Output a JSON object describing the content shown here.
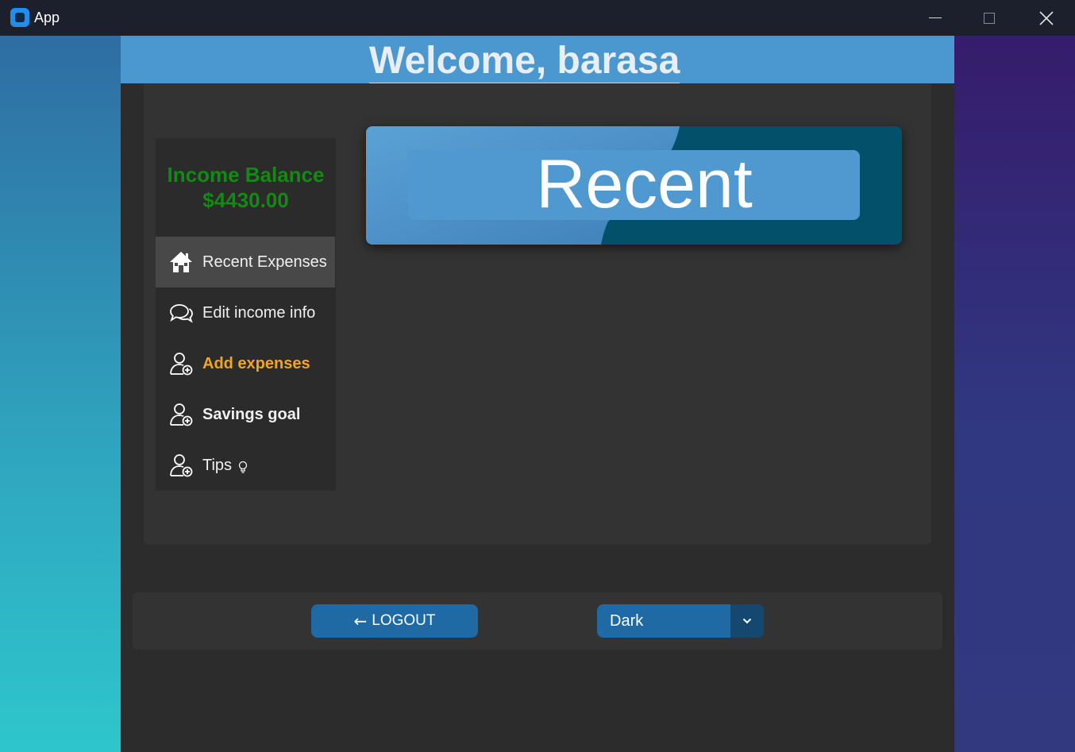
{
  "window": {
    "title": "App",
    "controls": [
      "minimize-icon",
      "maximize-icon",
      "close-icon"
    ]
  },
  "header": {
    "welcome": "Welcome, barasa"
  },
  "sidebar": {
    "balance_label": "Income Balance",
    "balance_value": "$4430.00",
    "items": [
      {
        "label": "Recent Expenses",
        "icon": "home-icon",
        "active": true
      },
      {
        "label": "Edit income info",
        "icon": "chat-icon",
        "active": false
      },
      {
        "label": "Add expenses",
        "icon": "add-user-icon",
        "active": false
      },
      {
        "label": "Savings goal",
        "icon": "add-user-icon",
        "active": false
      },
      {
        "label": "Tips",
        "icon": "add-user-icon",
        "active": false,
        "suffix_icon": "lightbulb-icon"
      }
    ]
  },
  "banner": {
    "title": "Recent"
  },
  "footer": {
    "logout_label": "LOGOUT",
    "theme_select": {
      "value": "Dark"
    }
  },
  "colors": {
    "accent": "#1f6aa5",
    "header": "#4b98d0",
    "balance": "#138a13",
    "highlight": "#f5a51d"
  }
}
